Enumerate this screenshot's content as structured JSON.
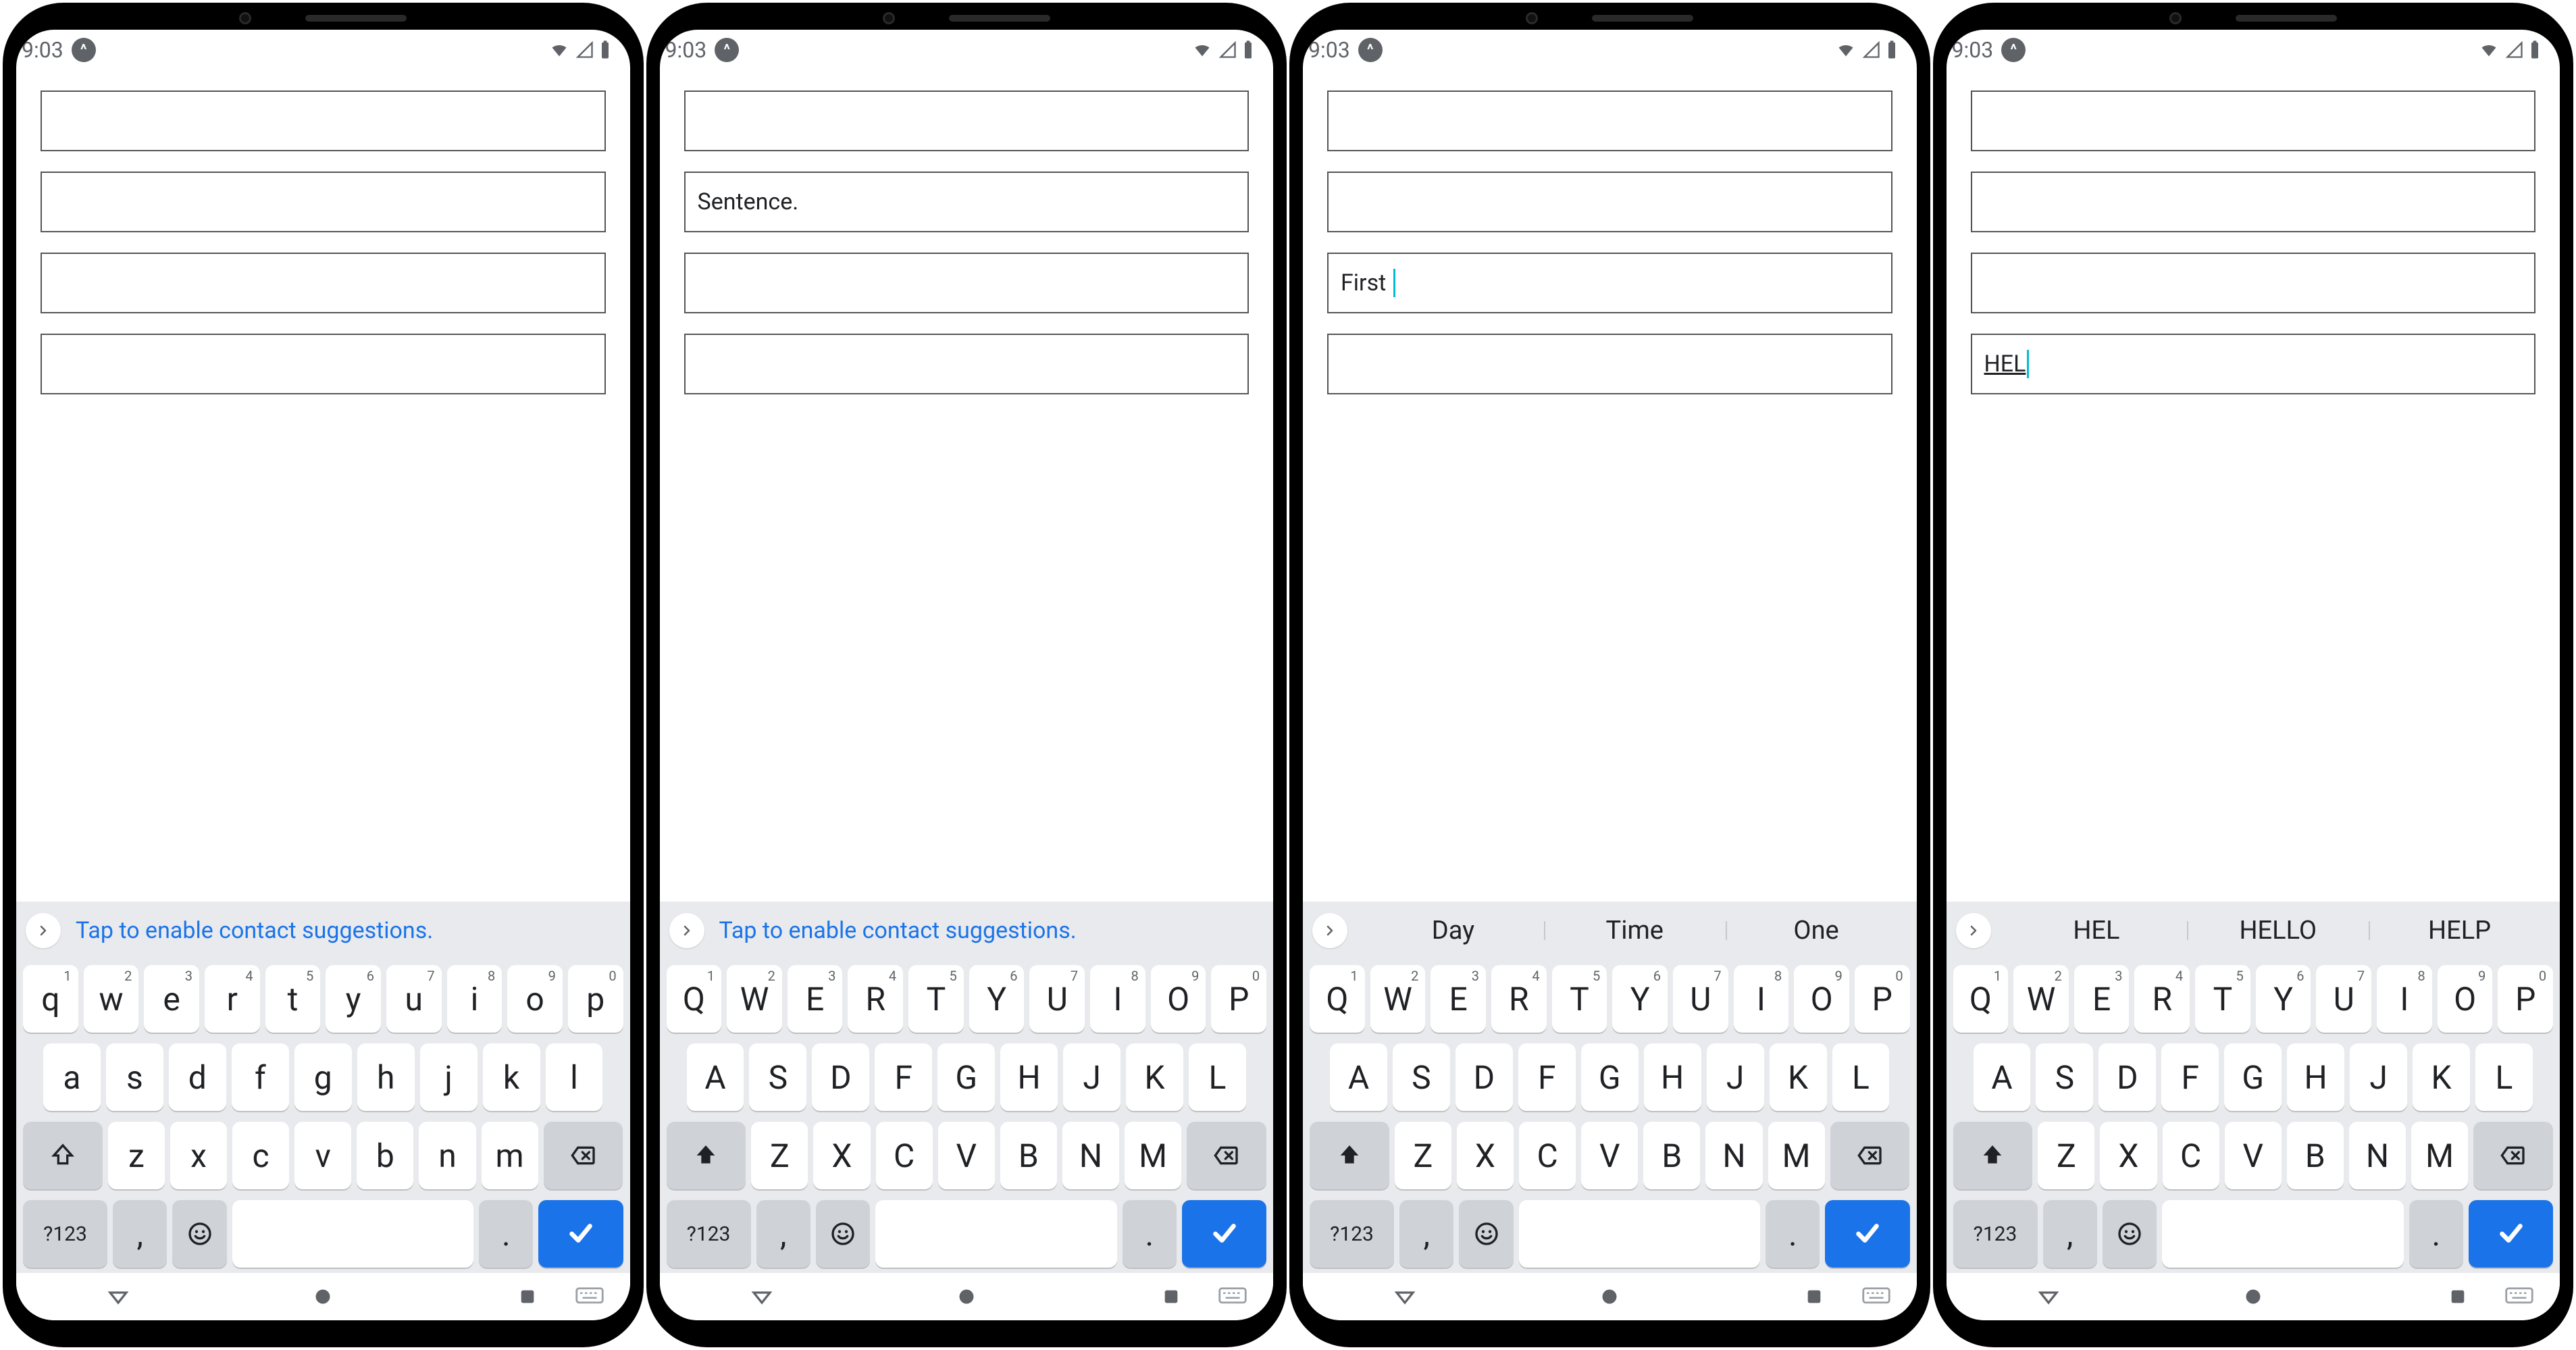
{
  "statusbar": {
    "time": "9:03"
  },
  "suggestion_link": "Tap to enable contact suggestions.",
  "phones": [
    {
      "keyboard_case": "lower",
      "suggestions": null,
      "show_link": true,
      "fields": [
        {
          "value": "",
          "active": false
        },
        {
          "value": "",
          "active": false
        },
        {
          "value": "",
          "active": false
        },
        {
          "value": "",
          "active": false
        }
      ]
    },
    {
      "keyboard_case": "upper",
      "suggestions": null,
      "show_link": true,
      "fields": [
        {
          "value": "",
          "active": false
        },
        {
          "value": "Sentence.",
          "active": false
        },
        {
          "value": "",
          "active": false
        },
        {
          "value": "",
          "active": false
        }
      ]
    },
    {
      "keyboard_case": "upper",
      "suggestions": [
        "Day",
        "Time",
        "One"
      ],
      "show_link": false,
      "fields": [
        {
          "value": "",
          "active": false
        },
        {
          "value": "",
          "active": false
        },
        {
          "value": "First ",
          "active": true
        },
        {
          "value": "",
          "active": false
        }
      ]
    },
    {
      "keyboard_case": "upper",
      "suggestions": [
        "HEL",
        "HELLO",
        "HELP"
      ],
      "show_link": false,
      "fields": [
        {
          "value": "",
          "active": false
        },
        {
          "value": "",
          "active": false
        },
        {
          "value": "",
          "active": false
        },
        {
          "value": "HEL",
          "active": true,
          "underline": true
        }
      ]
    }
  ],
  "keys": {
    "row1_lower": [
      "q",
      "w",
      "e",
      "r",
      "t",
      "y",
      "u",
      "i",
      "o",
      "p"
    ],
    "row1_upper": [
      "Q",
      "W",
      "E",
      "R",
      "T",
      "Y",
      "U",
      "I",
      "O",
      "P"
    ],
    "row1_sup": [
      "1",
      "2",
      "3",
      "4",
      "5",
      "6",
      "7",
      "8",
      "9",
      "0"
    ],
    "row2_lower": [
      "a",
      "s",
      "d",
      "f",
      "g",
      "h",
      "j",
      "k",
      "l"
    ],
    "row2_upper": [
      "A",
      "S",
      "D",
      "F",
      "G",
      "H",
      "J",
      "K",
      "L"
    ],
    "row3_lower": [
      "z",
      "x",
      "c",
      "v",
      "b",
      "n",
      "m"
    ],
    "row3_upper": [
      "Z",
      "X",
      "C",
      "V",
      "B",
      "N",
      "M"
    ],
    "symkey": "?123",
    "comma": ",",
    "period": "."
  }
}
